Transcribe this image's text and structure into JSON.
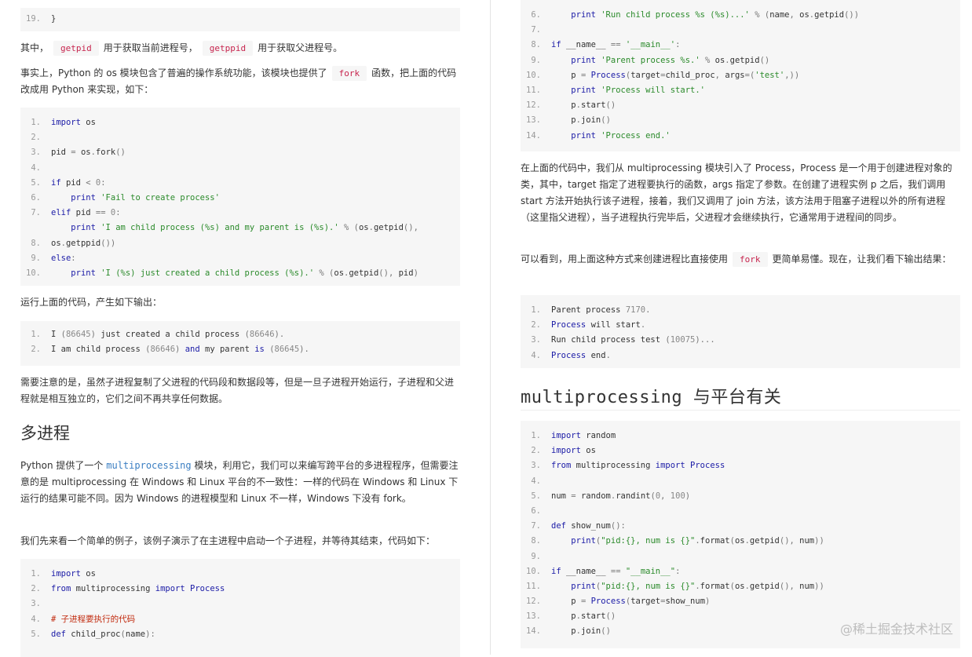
{
  "left": {
    "code_top": {
      "lines": [
        {
          "n": "19.",
          "t": "}"
        }
      ]
    },
    "p1": {
      "a": "其中，",
      "c1": "getpid",
      "b": "用于获取当前进程号，",
      "c2": "getppid",
      "d": "用于获取父进程号。"
    },
    "p2": {
      "a": "事实上，Python 的 os 模块包含了普遍的操作系统功能，该模块也提供了",
      "c": "fork",
      "b": "函数，把上面的代码改成用 Python 来实现，如下："
    },
    "code2": [
      {
        "n": "1.",
        "t": "import os"
      },
      {
        "n": "2.",
        "t": ""
      },
      {
        "n": "3.",
        "t": "pid = os.fork()"
      },
      {
        "n": "4.",
        "t": ""
      },
      {
        "n": "5.",
        "t": "if pid < 0:"
      },
      {
        "n": "6.",
        "t": "    print 'Fail to create process'"
      },
      {
        "n": "7.",
        "t": "elif pid == 0:"
      },
      {
        "n": "",
        "t": "    print 'I am child process (%s) and my parent is (%s).' % (os.getpid(),"
      },
      {
        "n": "8.",
        "t": "os.getppid())"
      },
      {
        "n": "9.",
        "t": "else:"
      },
      {
        "n": "10.",
        "t": "    print 'I (%s) just created a child process (%s).' % (os.getpid(), pid)"
      }
    ],
    "p3": "运行上面的代码，产生如下输出：",
    "code3": [
      {
        "n": "1.",
        "t": "I (86645) just created a child process (86646)."
      },
      {
        "n": "2.",
        "t": "I am child process (86646) and my parent is (86645)."
      }
    ],
    "p4": "需要注意的是，虽然子进程复制了父进程的代码段和数据段等，但是一旦子进程开始运行，子进程和父进程就是相互独立的，它们之间不再共享任何数据。",
    "h_multi": "多进程",
    "p5": {
      "a": "Python 提供了一个",
      "link": "multiprocessing",
      "b": "模块，利用它，我们可以来编写跨平台的多进程程序，但需要注意的是 multiprocessing 在 Windows 和 Linux 平台的不一致性：一样的代码在 Windows 和 Linux 下运行的结果可能不同。因为 Windows 的进程模型和 Linux 不一样，Windows 下没有 fork。"
    },
    "p6": "我们先来看一个简单的例子，该例子演示了在主进程中启动一个子进程，并等待其结束，代码如下：",
    "code4": [
      {
        "n": "1.",
        "t": "import os"
      },
      {
        "n": "2.",
        "t": "from multiprocessing import Process"
      },
      {
        "n": "3.",
        "t": ""
      },
      {
        "n": "4.",
        "t": "# 子进程要执行的代码"
      },
      {
        "n": "5.",
        "t": "def child_proc(name):"
      }
    ]
  },
  "right": {
    "code1": [
      {
        "n": "6.",
        "t": "    print 'Run child process %s (%s)...' % (name, os.getpid())"
      },
      {
        "n": "7.",
        "t": ""
      },
      {
        "n": "8.",
        "t": "if __name__ == '__main__':"
      },
      {
        "n": "9.",
        "t": "    print 'Parent process %s.' % os.getpid()"
      },
      {
        "n": "10.",
        "t": "    p = Process(target=child_proc, args=('test',))"
      },
      {
        "n": "11.",
        "t": "    print 'Process will start.'"
      },
      {
        "n": "12.",
        "t": "    p.start()"
      },
      {
        "n": "13.",
        "t": "    p.join()"
      },
      {
        "n": "14.",
        "t": "    print 'Process end.'"
      }
    ],
    "p1": "在上面的代码中，我们从 multiprocessing 模块引入了 Process，Process 是一个用于创建进程对象的类，其中，target 指定了进程要执行的函数，args 指定了参数。在创建了进程实例 p 之后，我们调用 start 方法开始执行该子进程，接着，我们又调用了 join 方法，该方法用于阻塞子进程以外的所有进程（这里指父进程），当子进程执行完毕后，父进程才会继续执行，它通常用于进程间的同步。",
    "p2": {
      "a": "可以看到，用上面这种方式来创建进程比直接使用",
      "c": "fork",
      "b": "更简单易懂。现在，让我们看下输出结果："
    },
    "code2": [
      {
        "n": "1.",
        "t": "Parent process 7170."
      },
      {
        "n": "2.",
        "t": "Process will start."
      },
      {
        "n": "3.",
        "t": "Run child process test (10075)..."
      },
      {
        "n": "4.",
        "t": "Process end."
      }
    ],
    "h_platform": "multiprocessing 与平台有关",
    "code3": [
      {
        "n": "1.",
        "t": "import random"
      },
      {
        "n": "2.",
        "t": "import os"
      },
      {
        "n": "3.",
        "t": "from multiprocessing import Process"
      },
      {
        "n": "4.",
        "t": ""
      },
      {
        "n": "5.",
        "t": "num = random.randint(0, 100)"
      },
      {
        "n": "6.",
        "t": ""
      },
      {
        "n": "7.",
        "t": "def show_num():"
      },
      {
        "n": "8.",
        "t": "    print(\"pid:{}, num is {}\".format(os.getpid(), num))"
      },
      {
        "n": "9.",
        "t": ""
      },
      {
        "n": "10.",
        "t": "if __name__ == \"__main__\":"
      },
      {
        "n": "11.",
        "t": "    print(\"pid:{}, num is {}\".format(os.getpid(), num))"
      },
      {
        "n": "12.",
        "t": "    p = Process(target=show_num)"
      },
      {
        "n": "13.",
        "t": "    p.start()"
      },
      {
        "n": "14.",
        "t": "    p.join()"
      }
    ]
  },
  "watermark": "@稀土掘金技术社区"
}
